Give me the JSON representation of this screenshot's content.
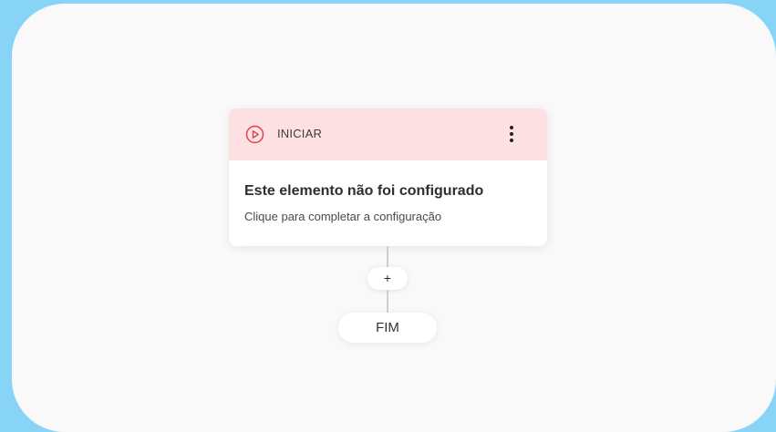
{
  "flow": {
    "start_node": {
      "header_label": "INICIAR",
      "icon": "play-circle-icon",
      "menu_icon": "more-vertical-icon",
      "title": "Este elemento não foi configurado",
      "subtitle": "Clique para completar a configuração"
    },
    "add_button_label": "+",
    "end_node_label": "FIM"
  },
  "colors": {
    "background": "#88d4f7",
    "canvas": "#f9f9f9",
    "header_bg": "#fde1e2",
    "accent_red": "#e0404a"
  }
}
